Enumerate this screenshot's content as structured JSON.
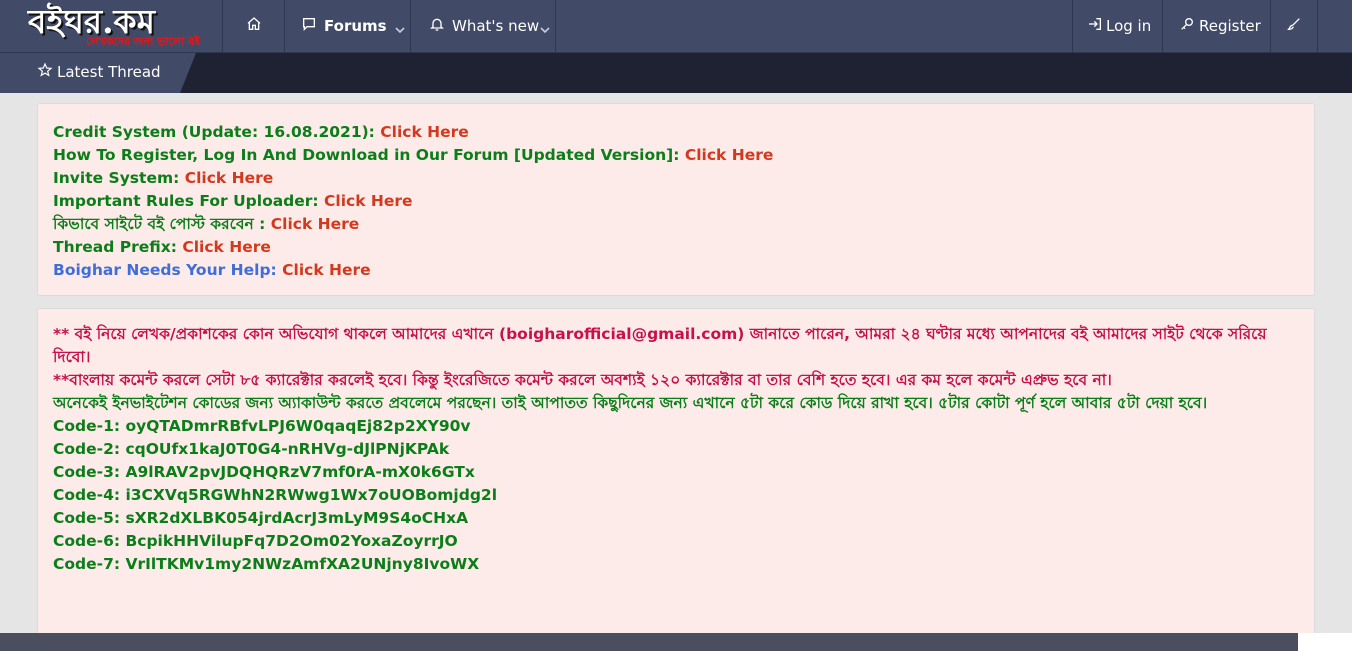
{
  "header": {
    "logo_text": "বইঘর.কম",
    "logo_subtext": "লেখকদের জন্য ভালো বই",
    "nav": {
      "home_icon": "home-icon",
      "forums_label": "Forums",
      "whats_new_label": "What's new",
      "login_label": "Log in",
      "register_label": "Register",
      "style_icon": "brush-icon"
    }
  },
  "subnav": {
    "latest_thread_label": "Latest Thread"
  },
  "notice1": {
    "lines": [
      {
        "text": "Credit System (Update: 16.08.2021): ",
        "link": "Click Here"
      },
      {
        "text": "How To Register, Log In And Download in Our Forum [Updated Version]: ",
        "link": "Click Here"
      },
      {
        "text": "Invite System: ",
        "link": "Click Here"
      },
      {
        "text": "Important Rules For Uploader: ",
        "link": "Click Here"
      },
      {
        "text": "কিভাবে সাইটে বই পোস্ট করবেন : ",
        "link": "Click Here"
      },
      {
        "text": "Thread Prefix: ",
        "link": "Click Here"
      },
      {
        "text": "Boighar Needs Your Help: ",
        "link": "Click Here"
      }
    ]
  },
  "notice2": {
    "para1": "** বই নিয়ে লেখক/প্রকাশকের কোন অভিযোগ থাকলে আমাদের এখানে (boigharofficial@gmail.com) জানাতে পারেন, আমরা ২৪ ঘণ্টার মধ্যে আপনাদের বই আমাদের সাইট থেকে সরিয়ে দিবো।",
    "para2": "**বাংলায় কমেন্ট করলে সেটা ৮৫ ক্যারেক্টার করলেই হবে। কিন্তু ইংরেজিতে কমেন্ট করলে অবশ্যই ১২০ ক্যারেক্টার বা তার বেশি হতে হবে। এর কম হলে কমেন্ট এপ্রুভ হবে না।",
    "para3": "অনেকেই ইনভাইটেশন কোডের জন্য অ্যাকাউন্ট করতে প্রবলেমে পরছেন। তাই আপাতত কিছুদিনের জন্য এখানে ৫টা করে কোড দিয়ে রাখা হবে। ৫টার কোটা পূর্ণ হলে আবার ৫টা দেয়া হবে।",
    "codes": [
      "Code-1: oyQTADmrRBfvLPJ6W0qaqEj82p2XY90v",
      "Code-2: cqOUfx1kaJ0T0G4-nRHVg-dJlPNjKPAk",
      "Code-3: A9lRAV2pvJDQHQRzV7mf0rA-mX0k6GTx",
      "Code-4: i3CXVq5RGWhN2RWwg1Wx7oUOBomjdg2l",
      "Code-5: sXR2dXLBK054jrdAcrJ3mLyM9S4oCHxA",
      "Code-6: BcpikHHVilupFq7D2Om02YoxaZoyrrJO",
      "Code-7: VrIlTKMv1my2NWzAmfXA2UNjny8IvoWX"
    ]
  }
}
